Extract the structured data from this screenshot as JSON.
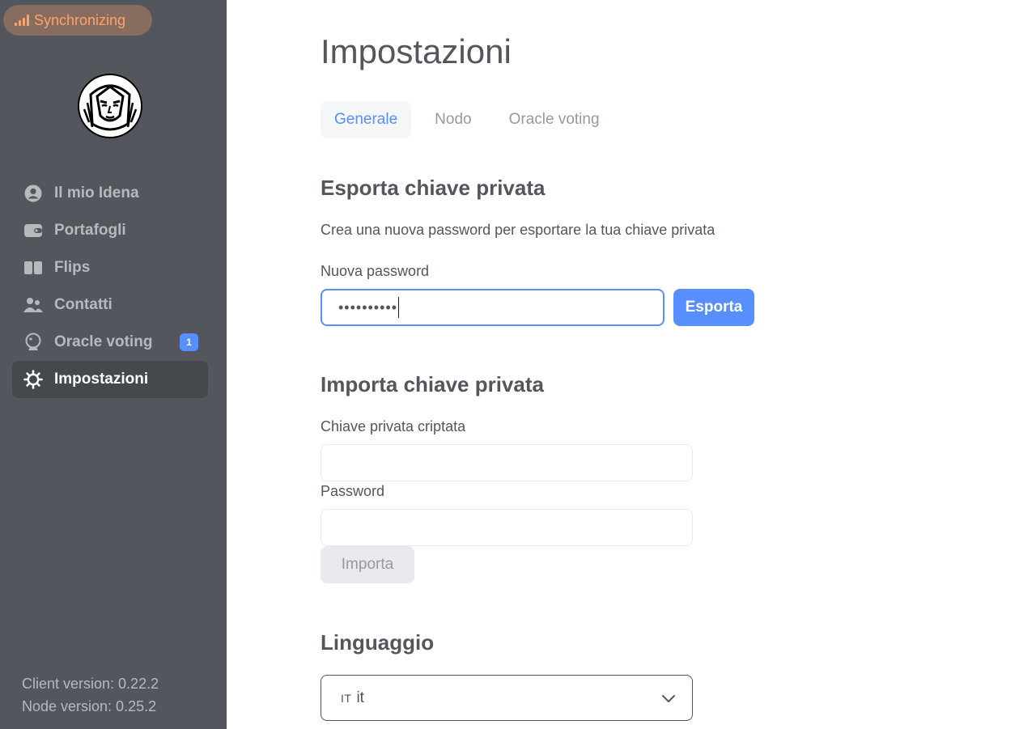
{
  "status": {
    "label": "Synchronizing",
    "icon": "signal-icon",
    "color": "#ffa366"
  },
  "sidebar": {
    "avatar_icon": "idena-logo-icon",
    "items": [
      {
        "label": "Il mio Idena",
        "icon": "user-circle-icon"
      },
      {
        "label": "Portafogli",
        "icon": "wallet-icon"
      },
      {
        "label": "Flips",
        "icon": "flips-icon"
      },
      {
        "label": "Contatti",
        "icon": "contacts-icon"
      },
      {
        "label": "Oracle voting",
        "icon": "oracle-icon",
        "badge": "1"
      },
      {
        "label": "Impostazioni",
        "icon": "gear-icon",
        "active": true
      }
    ],
    "client_version": "Client version: 0.22.2",
    "node_version": "Node version: 0.25.2"
  },
  "page": {
    "title": "Impostazioni",
    "tabs": [
      {
        "label": "Generale",
        "active": true
      },
      {
        "label": "Nodo"
      },
      {
        "label": "Oracle voting"
      }
    ]
  },
  "export": {
    "title": "Esporta chiave privata",
    "description": "Crea una nuova password per esportare la tua chiave privata",
    "password_label": "Nuova password",
    "password_value": "••••••••••",
    "button": "Esporta"
  },
  "import": {
    "title": "Importa chiave privata",
    "key_label": "Chiave privata criptata",
    "key_value": "",
    "password_label": "Password",
    "password_value": "",
    "button": "Importa"
  },
  "language": {
    "title": "Linguaggio",
    "flag": "IT",
    "selected": "it"
  },
  "colors": {
    "sidebar": "#53565c",
    "accent": "#578fff",
    "warning": "#ffa366"
  }
}
